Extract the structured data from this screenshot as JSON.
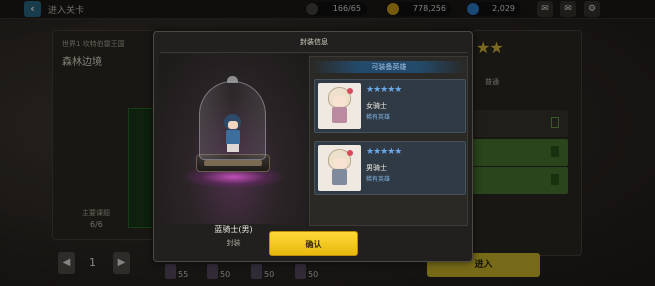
{
  "topbar": {
    "back_icon": "arrow-left-icon",
    "title": "进入关卡",
    "stamina": "166/65",
    "gold": "778,256",
    "gems": "2,029",
    "icons": [
      "chat-icon",
      "mail-icon",
      "settings-icon"
    ]
  },
  "left_panel": {
    "world_label": "世界1 坎特伯雷王国",
    "stage_name": "森林边境",
    "mission_label": "主要课题",
    "mission_count": "6/6"
  },
  "pager": {
    "prev_icon": "◀",
    "page": "1",
    "next_icon": "▶"
  },
  "bottom_stats": [
    "55",
    "50",
    "50",
    "50"
  ],
  "right_panel": {
    "tab_label": "普通",
    "enter_label": "进入"
  },
  "modal": {
    "title": "封装信息",
    "hero_name": "蓝骑士(男)",
    "hero_subtitle": "封装",
    "list_header": "可装备英雄",
    "cards": [
      {
        "name": "女骑士",
        "stars": "★★★★★",
        "rarity": "稀有英雄"
      },
      {
        "name": "男骑士",
        "stars": "★★★★★",
        "rarity": "稀有英雄"
      }
    ],
    "confirm_label": "确认"
  },
  "colors": {
    "accent_yellow": "#ffd93a",
    "star_blue": "#6aa7e6",
    "rarity_blue": "#7fb2e0",
    "glow_purple": "#c04fb6"
  }
}
